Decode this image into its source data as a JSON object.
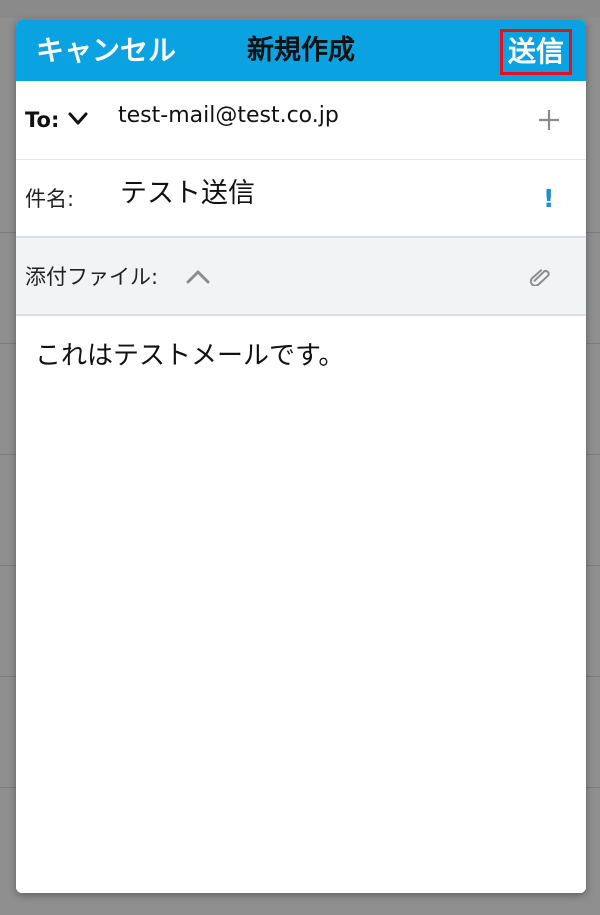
{
  "header": {
    "cancel_label": "キャンセル",
    "title": "新規作成",
    "send_label": "送信"
  },
  "to": {
    "label": "To:",
    "value": "test-mail@test.co.jp"
  },
  "subject": {
    "label": "件名:",
    "value": "テスト送信",
    "importance_icon": "!"
  },
  "attachments": {
    "label": "添付ファイル:"
  },
  "body": {
    "text": "これはテストメールです。"
  },
  "colors": {
    "header_bg": "#0aa2e0",
    "send_highlight": "#e3131b",
    "importance": "#1a8fd6"
  }
}
